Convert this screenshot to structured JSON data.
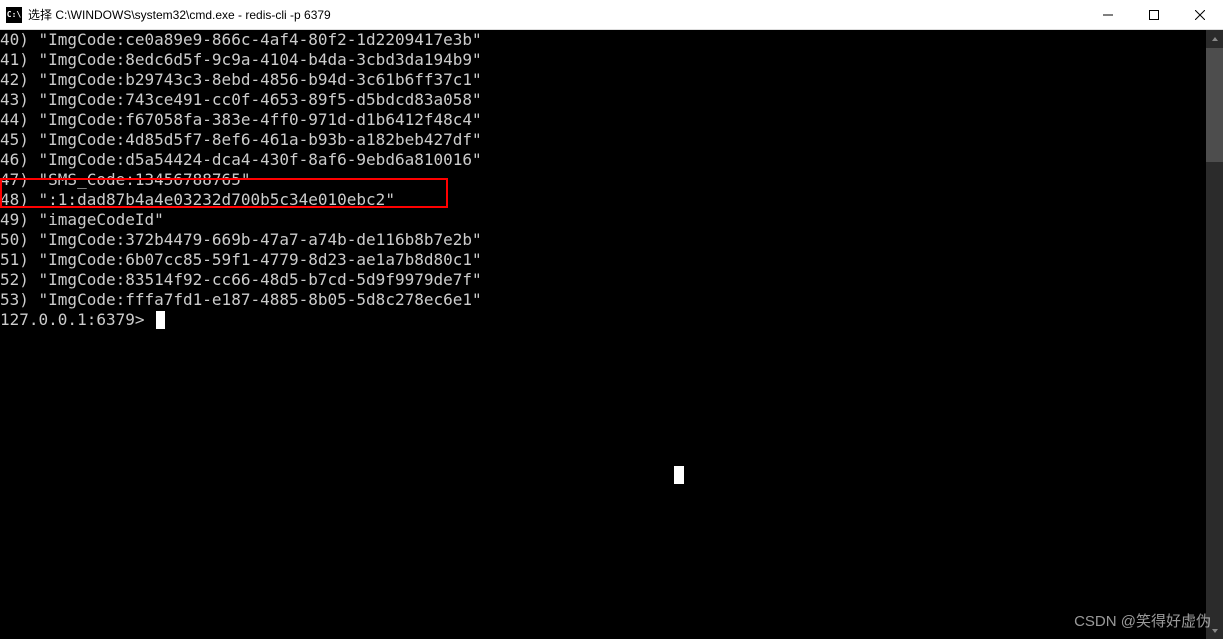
{
  "window": {
    "icon_label": "cmd",
    "title": "选择 C:\\WINDOWS\\system32\\cmd.exe - redis-cli  -p 6379"
  },
  "terminal": {
    "lines": [
      {
        "n": "40",
        "text": "\"ImgCode:ce0a89e9-866c-4af4-80f2-1d2209417e3b\"",
        "highlight": false
      },
      {
        "n": "41",
        "text": "\"ImgCode:8edc6d5f-9c9a-4104-b4da-3cbd3da194b9\"",
        "highlight": false
      },
      {
        "n": "42",
        "text": "\"ImgCode:b29743c3-8ebd-4856-b94d-3c61b6ff37c1\"",
        "highlight": false
      },
      {
        "n": "43",
        "text": "\"ImgCode:743ce491-cc0f-4653-89f5-d5bdcd83a058\"",
        "highlight": false
      },
      {
        "n": "44",
        "text": "\"ImgCode:f67058fa-383e-4ff0-971d-d1b6412f48c4\"",
        "highlight": false
      },
      {
        "n": "45",
        "text": "\"ImgCode:4d85d5f7-8ef6-461a-b93b-a182beb427df\"",
        "highlight": false
      },
      {
        "n": "46",
        "text": "\"ImgCode:d5a54424-dca4-430f-8af6-9ebd6a810016\"",
        "highlight": false
      },
      {
        "n": "47",
        "text": "\"SMS_Code:13456788765\"",
        "highlight": false
      },
      {
        "n": "48",
        "text": "\":1:dad87b4a4e03232d700b5c34e010ebc2\"",
        "highlight": true
      },
      {
        "n": "49",
        "text": "\"imageCodeId\"",
        "highlight": false
      },
      {
        "n": "50",
        "text": "\"ImgCode:372b4479-669b-47a7-a74b-de116b8b7e2b\"",
        "highlight": false
      },
      {
        "n": "51",
        "text": "\"ImgCode:6b07cc85-59f1-4779-8d23-ae1a7b8d80c1\"",
        "highlight": false
      },
      {
        "n": "52",
        "text": "\"ImgCode:83514f92-cc66-48d5-b7cd-5d9f9979de7f\"",
        "highlight": false
      },
      {
        "n": "53",
        "text": "\"ImgCode:fffa7fd1-e187-4885-8b05-5d8c278ec6e1\"",
        "highlight": false
      }
    ],
    "prompt": "127.0.0.1:6379> "
  },
  "watermark": "CSDN @笑得好虚伪"
}
